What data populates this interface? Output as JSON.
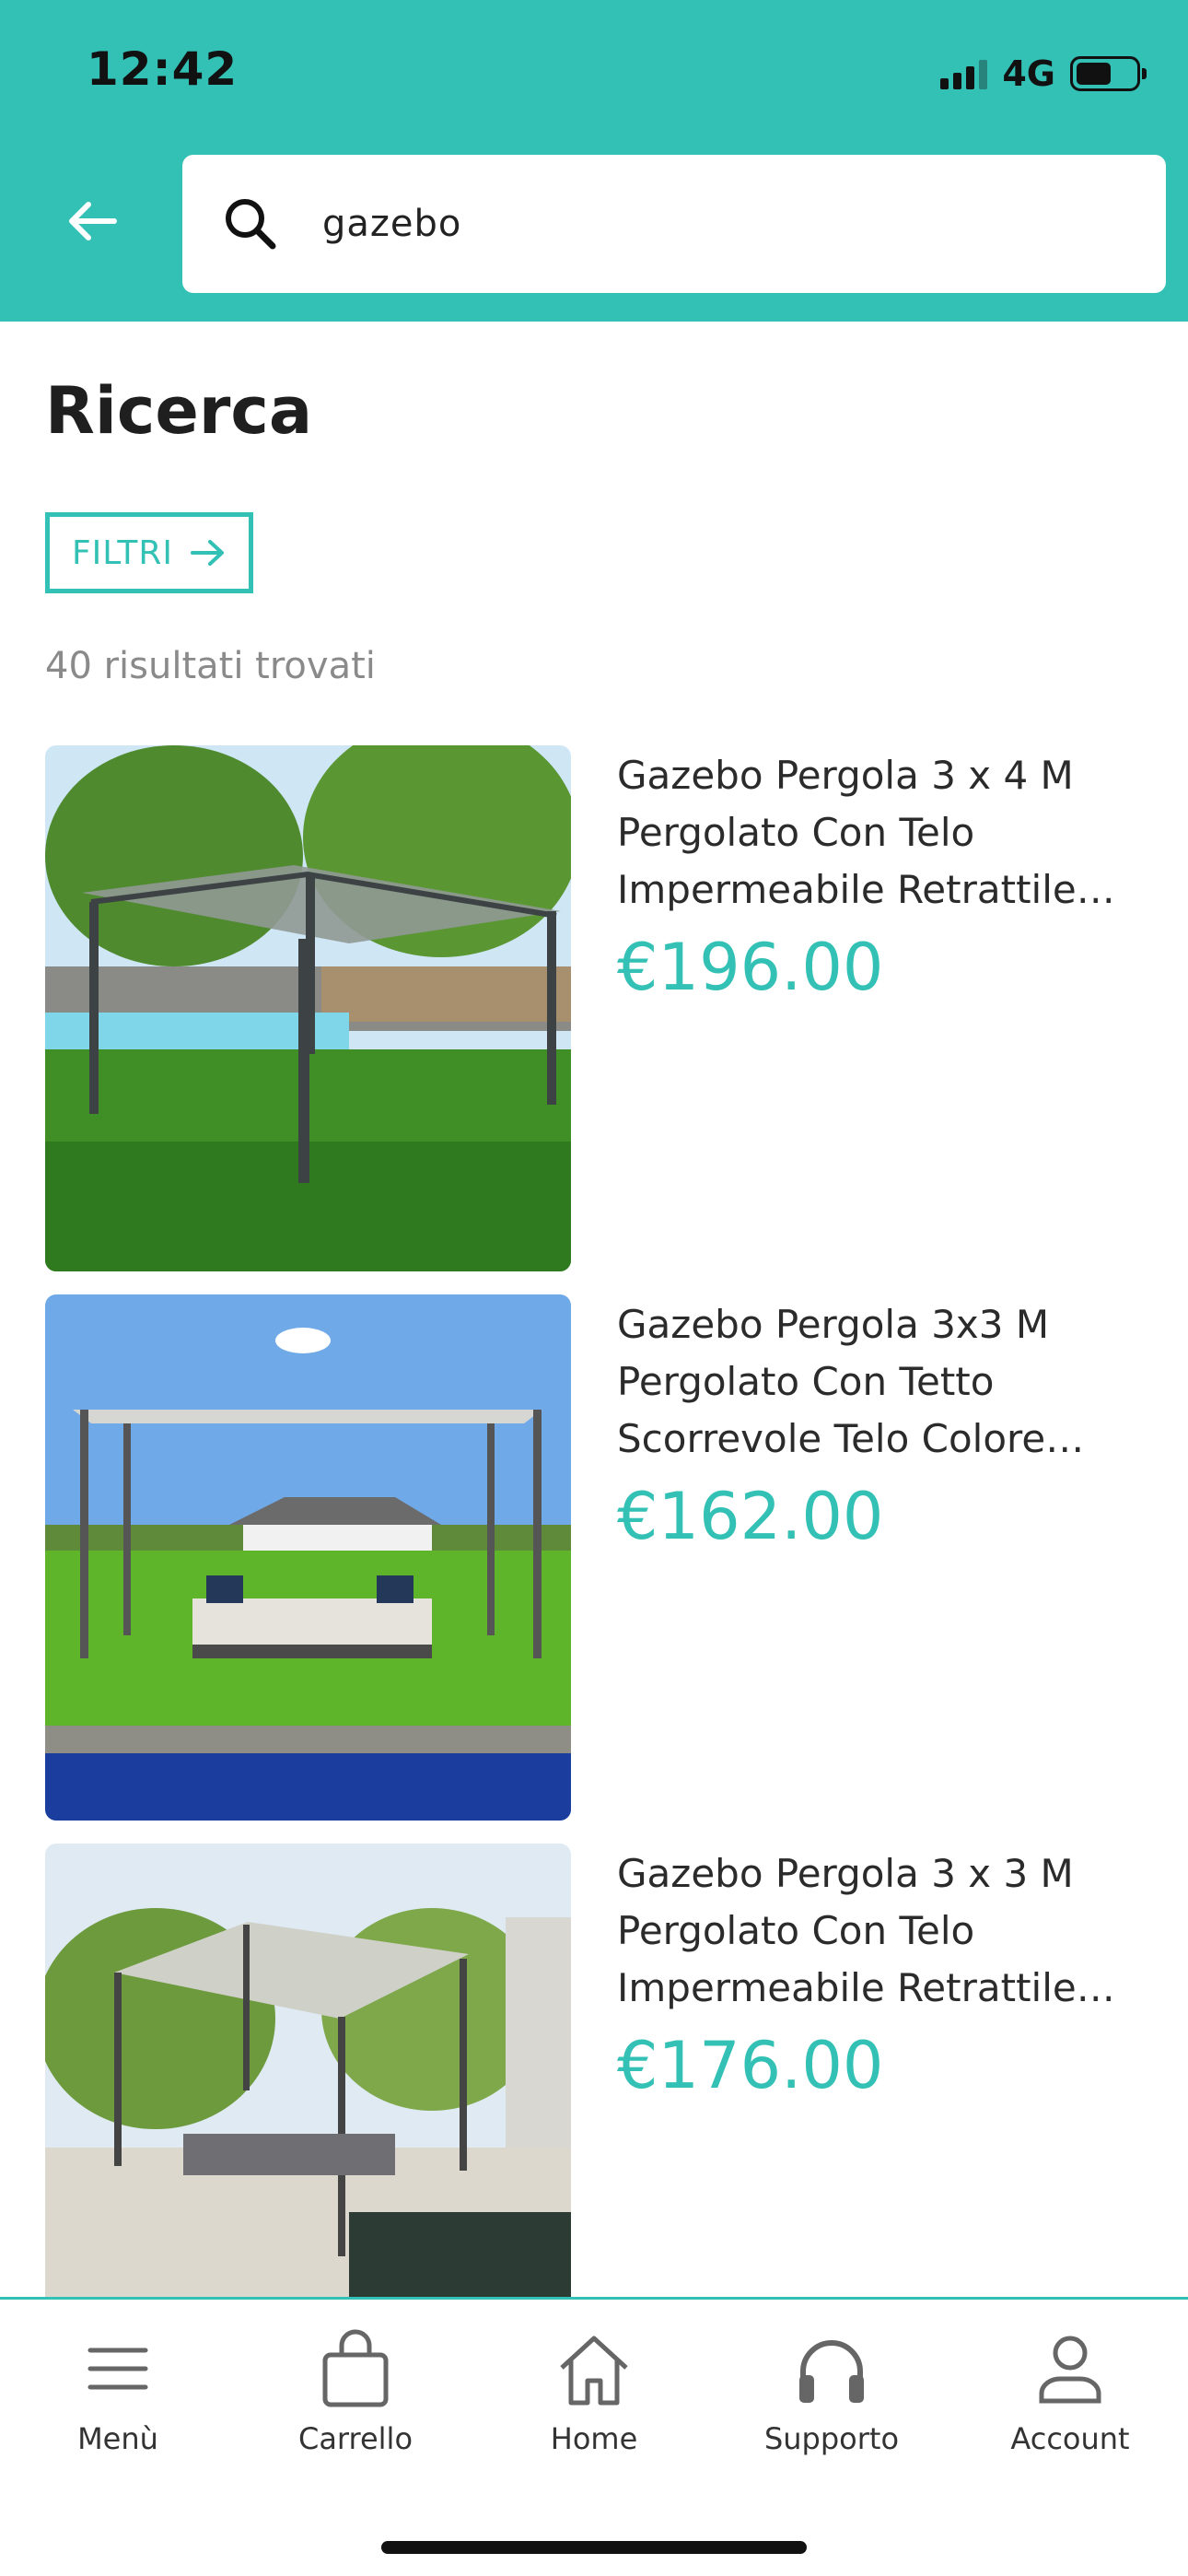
{
  "status_bar": {
    "time": "12:42",
    "network": "4G",
    "battery_level": 0.6
  },
  "header": {
    "search_value": "gazebo"
  },
  "page": {
    "title": "Ricerca",
    "filter_label": "FILTRI",
    "result_count": "40 risultati trovati"
  },
  "products": [
    {
      "title": "Gazebo Pergola 3 x 4 M Pergolato Con Telo Impermeabile Retrattile Richiudibile",
      "price": "€196.00"
    },
    {
      "title": "Gazebo Pergola 3x3 M Pergolato Con Tetto Scorrevole Telo Colore Grigio",
      "price": "€162.00"
    },
    {
      "title": "Gazebo Pergola 3 x 3 M Pergolato Con Telo Impermeabile Retrattile Richiudibile",
      "price": "€176.00"
    }
  ],
  "bottom_nav": [
    {
      "label": "Menù",
      "icon": "menu-icon"
    },
    {
      "label": "Carrello",
      "icon": "bag-icon"
    },
    {
      "label": "Home",
      "icon": "home-icon"
    },
    {
      "label": "Supporto",
      "icon": "headphones-icon"
    },
    {
      "label": "Account",
      "icon": "user-icon"
    }
  ],
  "colors": {
    "accent": "#33c0b5",
    "text": "#222222",
    "muted": "#8a8a8a"
  }
}
